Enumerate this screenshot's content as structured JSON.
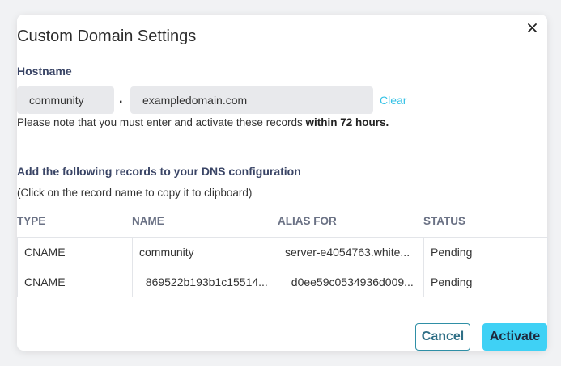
{
  "dialog": {
    "title": "Custom Domain Settings",
    "close_icon": "close-icon"
  },
  "hostname": {
    "label": "Hostname",
    "subdomain_value": "community",
    "separator": ".",
    "domain_value": "exampledomain.com",
    "clear_label": "Clear"
  },
  "note": {
    "text": "Please note that you must enter and activate these records ",
    "bold": "within 72 hours."
  },
  "dns": {
    "heading": "Add the following records to your DNS configuration",
    "hint": "(Click on the record name to copy it to clipboard)",
    "columns": [
      "TYPE",
      "NAME",
      "ALIAS FOR",
      "STATUS"
    ],
    "rows": [
      [
        "CNAME",
        "community",
        "server-e4054763.white...",
        "Pending"
      ],
      [
        "CNAME",
        "_869522b193b1c15514...",
        "_d0ee59c0534936d009...",
        "Pending"
      ]
    ]
  },
  "actions": {
    "cancel_label": "Cancel",
    "activate_label": "Activate"
  }
}
